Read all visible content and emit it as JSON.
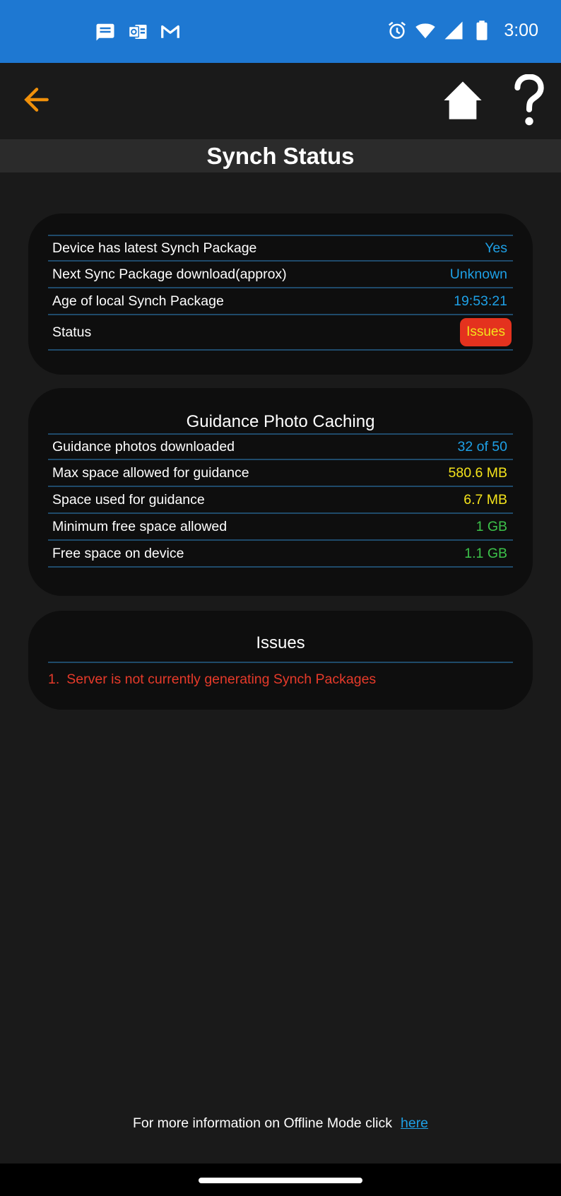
{
  "statusbar": {
    "time": "3:00",
    "left_icons": [
      "messages-icon",
      "outlook-icon",
      "gmail-icon"
    ],
    "right_icons": [
      "alarm-icon",
      "wifi-icon",
      "signal-icon",
      "battery-icon"
    ]
  },
  "toolbar": {
    "back_icon": "arrow-left-icon",
    "home_icon": "home-icon",
    "help_icon": "help-icon",
    "back_color": "#f0900a"
  },
  "title": "Synch Status",
  "synch": {
    "rows": [
      {
        "label": "Device has latest Synch Package",
        "value": "Yes"
      },
      {
        "label": "Next Sync Package download(approx)",
        "value": "Unknown"
      },
      {
        "label": "Age of local Synch Package",
        "value": "19:53:21"
      },
      {
        "label": "Status",
        "value": "Issues"
      }
    ]
  },
  "photo_caching": {
    "title": "Guidance Photo Caching",
    "rows": [
      {
        "label": "Guidance photos downloaded",
        "value": "32 of 50"
      },
      {
        "label": "Max space allowed for guidance",
        "value": "580.6 MB"
      },
      {
        "label": "Space used for guidance",
        "value": "6.7 MB"
      },
      {
        "label": "Minimum free space allowed",
        "value": "1 GB"
      },
      {
        "label": "Free space on device",
        "value": "1.1 GB"
      }
    ]
  },
  "issues": {
    "title": "Issues",
    "items": [
      {
        "num": "1.",
        "text": "Server is not currently generating Synch Packages"
      }
    ]
  },
  "footer": {
    "text": "For more information on Offline Mode click",
    "link": "here"
  },
  "colors": {
    "statusbar": "#1e78d2",
    "value_blue": "#1ea0e6",
    "value_yellow": "#f4e31b",
    "value_green": "#3cc24a",
    "issue_red": "#e63a2a",
    "badge_red": "#e4321e"
  }
}
